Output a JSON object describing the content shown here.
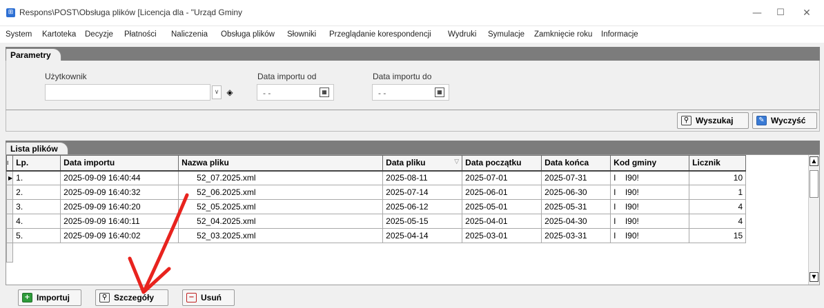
{
  "window": {
    "title": "Respons\\POST\\Obsługa plików [Licencja dla - \"Urząd Gminy",
    "icon": "app-icon",
    "minimize_glyph": "—",
    "maximize_glyph": "☐",
    "close_glyph": "✕"
  },
  "menu": [
    "System",
    "Kartoteka",
    "Decyzje",
    "Płatności",
    "Naliczenia",
    "Obsługa plików",
    "Słowniki",
    "Przeglądanie korespondencji",
    "Wydruki",
    "Symulacje",
    "Zamknięcie roku",
    "Informacje"
  ],
  "params_tab": "Parametry",
  "params": {
    "user_label": "Użytkownik",
    "user_value": "",
    "date_from_label": "Data importu od",
    "date_from_value": "- -",
    "date_to_label": "Data importu do",
    "date_to_value": "- -"
  },
  "actions": {
    "search": "Wyszukaj",
    "clear": "Wyczyść"
  },
  "list_tab": "Lista plików",
  "table": {
    "columns": [
      "Lp.",
      "Data importu",
      "Nazwa pliku",
      "Data pliku",
      "Data początku",
      "Data końca",
      "Kod gminy",
      "Licznik"
    ],
    "rows": [
      {
        "lp": "1.",
        "import": "2025-09-09 16:40:44",
        "file": "52_07.2025.xml",
        "filedate": "2025-08-11",
        "start": "2025-07-01",
        "end": "2025-07-31",
        "code": "I    I90!",
        "count": "10"
      },
      {
        "lp": "2.",
        "import": "2025-09-09 16:40:32",
        "file": "52_06.2025.xml",
        "filedate": "2025-07-14",
        "start": "2025-06-01",
        "end": "2025-06-30",
        "code": "I    I90!",
        "count": "1"
      },
      {
        "lp": "3.",
        "import": "2025-09-09 16:40:20",
        "file": "52_05.2025.xml",
        "filedate": "2025-06-12",
        "start": "2025-05-01",
        "end": "2025-05-31",
        "code": "I    I90!",
        "count": "4"
      },
      {
        "lp": "4.",
        "import": "2025-09-09 16:40:11",
        "file": "52_04.2025.xml",
        "filedate": "2025-05-15",
        "start": "2025-04-01",
        "end": "2025-04-30",
        "code": "I    I90!",
        "count": "4"
      },
      {
        "lp": "5.",
        "import": "2025-09-09 16:40:02",
        "file": "52_03.2025.xml",
        "filedate": "2025-04-14",
        "start": "2025-03-01",
        "end": "2025-03-31",
        "code": "I    I90!",
        "count": "15"
      }
    ]
  },
  "bottom": {
    "import": "Importuj",
    "details": "Szczegóły",
    "delete": "Usuń"
  },
  "colors": {
    "annotation_arrow": "#e8231e",
    "tab_strip": "#7c7c7c"
  }
}
